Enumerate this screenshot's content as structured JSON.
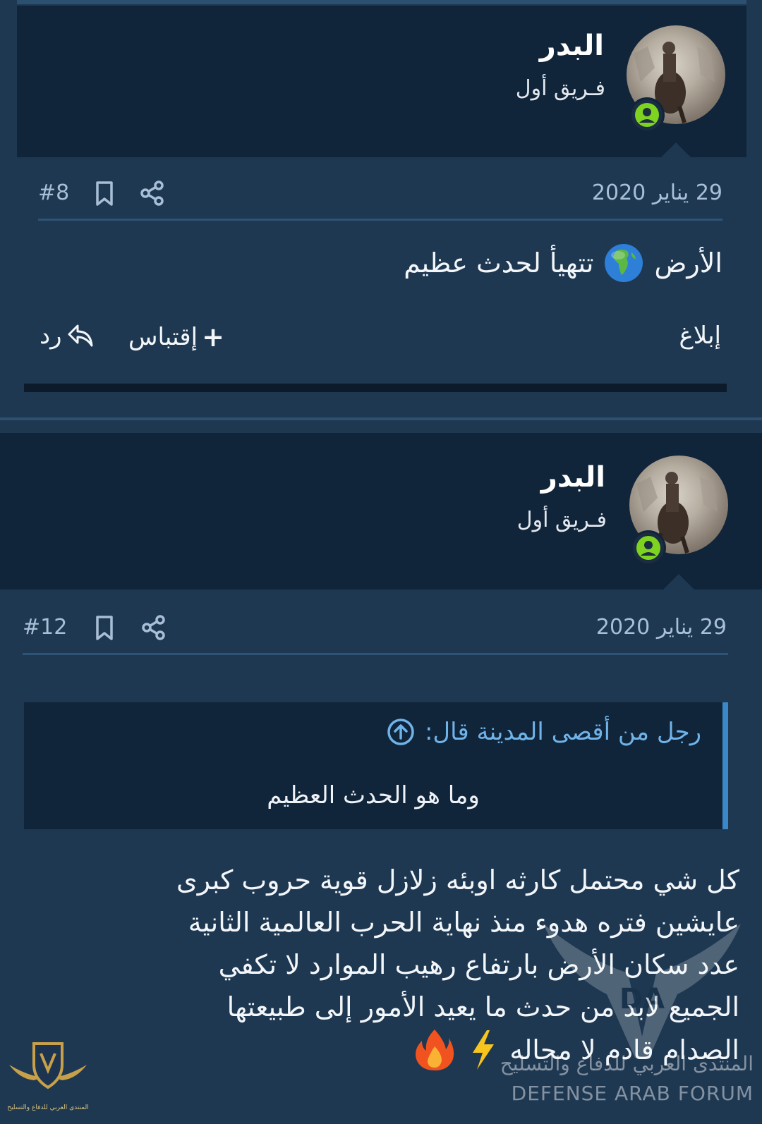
{
  "posts": [
    {
      "username": "البدر",
      "usertitle": "فـريق أول",
      "date": "29 يناير 2020",
      "post_number": "#8",
      "body_before_emoji": "الأرض",
      "body_after_emoji": "تتهيأ لحدث عظيم",
      "actions": {
        "report": "إبلاغ",
        "quote": "إقتباس",
        "reply": "رد"
      }
    },
    {
      "username": "البدر",
      "usertitle": "فـريق أول",
      "date": "29 يناير 2020",
      "post_number": "#12",
      "quote": {
        "author_line": "رجل من أقصى المدينة قال:",
        "text": "وما هو الحدث العظيم"
      },
      "body_lines": [
        "كل شي محتمل كارثه اوبئه زلازل قوية حروب كبرى",
        "عايشين فتره هدوء منذ نهاية الحرب العالمية الثانية",
        "عدد سكان الأرض بارتفاع رهيب الموارد لا تكفي",
        "الجميع لابد من حدث ما يعيد الأمور إلى طبيعتها",
        "الصدام قادم لا محاله"
      ]
    }
  ],
  "watermark": {
    "arabic": "المنتدى العربي للدفاع والتسليح",
    "english": "DEFENSE ARAB FORUM",
    "corner_caption": "المنتدى العربي للدفاع والتسليح"
  },
  "colors": {
    "background": "#1e3852",
    "header": "#10243a",
    "accent": "#3a88c8",
    "online": "#7ed321"
  }
}
